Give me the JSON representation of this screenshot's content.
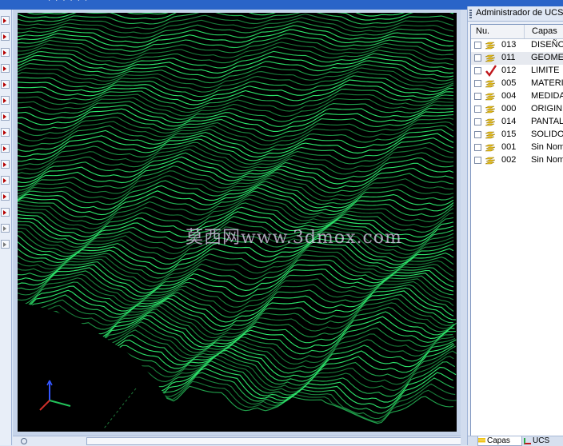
{
  "panel": {
    "title": "Administrador de UCS",
    "columns": {
      "number": "Nu.",
      "name": "Capas"
    },
    "layers": [
      {
        "number": "013",
        "name": "DISEÑO",
        "checked": false,
        "current": false,
        "selected": false
      },
      {
        "number": "011",
        "name": "GEOME",
        "checked": false,
        "current": false,
        "selected": true
      },
      {
        "number": "012",
        "name": "LIMITE",
        "checked": false,
        "current": true,
        "selected": false
      },
      {
        "number": "005",
        "name": "MATERI",
        "checked": false,
        "current": false,
        "selected": false
      },
      {
        "number": "004",
        "name": "MEDIDA",
        "checked": false,
        "current": false,
        "selected": false
      },
      {
        "number": "000",
        "name": "ORIGIN",
        "checked": false,
        "current": false,
        "selected": false
      },
      {
        "number": "014",
        "name": "PANTAL",
        "checked": false,
        "current": false,
        "selected": false
      },
      {
        "number": "015",
        "name": "SOLIDO",
        "checked": false,
        "current": false,
        "selected": false
      },
      {
        "number": "001",
        "name": "Sin Nom",
        "checked": false,
        "current": false,
        "selected": false
      },
      {
        "number": "002",
        "name": "Sin Nom",
        "checked": false,
        "current": false,
        "selected": false
      }
    ],
    "tabs": [
      {
        "label": "Capas",
        "icon": "layers-icon",
        "active": true
      },
      {
        "label": "UCS",
        "icon": "ucs-axes-icon",
        "active": false
      }
    ]
  },
  "viewport": {
    "watermark": "莫西网www.3dmox.com",
    "background": "#000000",
    "mesh_color": "#2ee86c",
    "axes": {
      "x_color": "#22c25a",
      "y_color": "#22c25a",
      "z_color": "#3355ff"
    }
  },
  "toolbar": {
    "tool_icons": [
      "arrow-tool-icon",
      "arrow-tool-icon",
      "arrow-tool-icon",
      "arrow-tool-icon",
      "arrow-tool-icon",
      "arrow-tool-icon",
      "arrow-tool-icon",
      "arrow-tool-icon",
      "arrow-tool-icon",
      "arrow-tool-icon",
      "arrow-tool-icon",
      "arrow-tool-icon",
      "arrow-tool-icon",
      "arrow-tool-icon",
      "arrow-tool-icon"
    ]
  },
  "colors": {
    "accent": "#2a64c8",
    "selection": "#e6e9ef"
  }
}
